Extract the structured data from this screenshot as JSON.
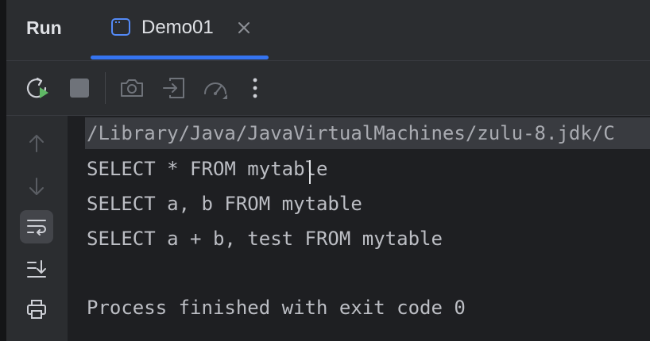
{
  "header": {
    "panel_title": "Run",
    "tab": {
      "label": "Demo01",
      "icon": "app-window-icon",
      "close_icon": "close-icon"
    }
  },
  "toolbar": {
    "buttons": [
      {
        "name": "rerun-button",
        "icon": "rerun-icon"
      },
      {
        "name": "stop-button",
        "icon": "stop-icon"
      },
      {
        "name": "screenshot-button",
        "icon": "camera-icon"
      },
      {
        "name": "restore-layout-button",
        "icon": "enter-icon"
      },
      {
        "name": "profiler-button",
        "icon": "speedometer-icon"
      },
      {
        "name": "more-button",
        "icon": "more-vertical-icon"
      }
    ]
  },
  "gutter": {
    "buttons": [
      {
        "name": "up-stack-button",
        "icon": "arrow-up-icon"
      },
      {
        "name": "down-stack-button",
        "icon": "arrow-down-icon"
      },
      {
        "name": "soft-wrap-button",
        "icon": "soft-wrap-icon",
        "active": true
      },
      {
        "name": "scroll-to-end-button",
        "icon": "scroll-to-end-icon"
      },
      {
        "name": "print-button",
        "icon": "printer-icon"
      }
    ]
  },
  "console": {
    "lines": [
      "/Library/Java/JavaVirtualMachines/zulu-8.jdk/C",
      "SELECT * FROM mytable",
      "SELECT a, b FROM mytable",
      "SELECT a + b, test FROM mytable",
      "",
      "Process finished with exit code 0"
    ]
  },
  "colors": {
    "accent": "#3574f0",
    "run_green": "#5fb865",
    "background": "#1e1f22",
    "panel": "#2b2d30"
  }
}
